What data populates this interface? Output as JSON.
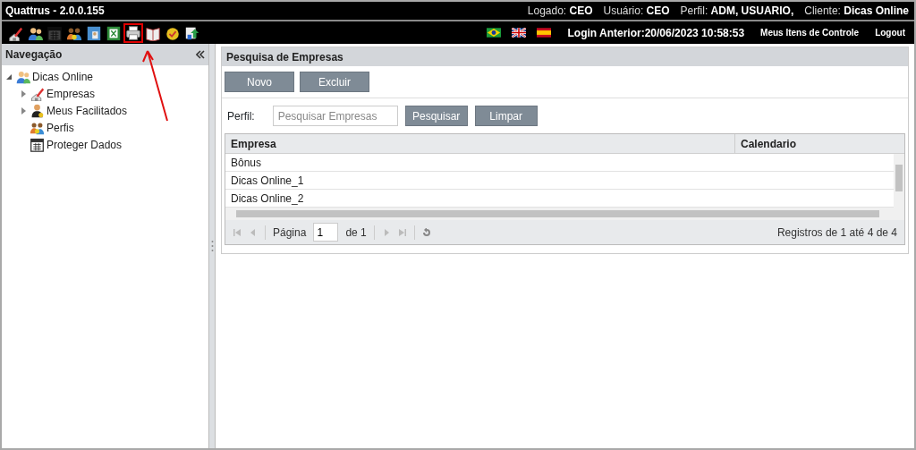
{
  "header": {
    "app_title": "Quattrus - 2.0.0.155",
    "session": [
      {
        "label": "Logado:",
        "value": "CEO"
      },
      {
        "label": "Usuário:",
        "value": "CEO"
      },
      {
        "label": "Perfil:",
        "value": "ADM, USUARIO,"
      },
      {
        "label": "Cliente:",
        "value": "Dicas Online"
      }
    ]
  },
  "toolbar": [
    {
      "kind": "house",
      "disabled": false,
      "highlighted": false
    },
    {
      "kind": "users",
      "disabled": false,
      "highlighted": false
    },
    {
      "kind": "calendar",
      "disabled": true,
      "highlighted": false
    },
    {
      "kind": "people",
      "disabled": false,
      "highlighted": false
    },
    {
      "kind": "image",
      "disabled": false,
      "highlighted": false
    },
    {
      "kind": "sheet",
      "disabled": false,
      "highlighted": false
    },
    {
      "kind": "printer",
      "disabled": false,
      "highlighted": true
    },
    {
      "kind": "book",
      "disabled": false,
      "highlighted": false
    },
    {
      "kind": "badge",
      "disabled": false,
      "highlighted": false
    },
    {
      "kind": "sync",
      "disabled": false,
      "highlighted": false
    }
  ],
  "languages": [
    {
      "kind": "brazil"
    },
    {
      "kind": "uk"
    },
    {
      "kind": "spain"
    }
  ],
  "last_login": "Login Anterior:20/06/2023 10:58:53",
  "links": [
    "Meus Itens de Controle",
    "Logout"
  ],
  "sidebar": {
    "title": "Navegação",
    "tree": [
      {
        "label": "Dicas Online",
        "kind": "users",
        "expanded": true,
        "children": [
          {
            "label": "Empresas",
            "kind": "house",
            "expanded": false
          },
          {
            "label": "Meus Facilitados",
            "kind": "person",
            "expanded": false
          },
          {
            "label": "Perfis",
            "kind": "people"
          },
          {
            "label": "Proteger Dados",
            "kind": "calendar"
          }
        ]
      }
    ]
  },
  "panel": {
    "title": "Pesquisa de Empresas",
    "actions": [
      "Novo",
      "Excluir"
    ],
    "search": {
      "label": "Perfil:",
      "placeholder": "Pesquisar Empresas",
      "buttons": [
        "Pesquisar",
        "Limpar"
      ]
    },
    "table": {
      "columns": [
        "Empresa",
        "Calendario"
      ],
      "rows": [
        {
          "empresa": "Bônus"
        },
        {
          "empresa": "Dicas Online_1"
        },
        {
          "empresa": "Dicas Online_2"
        }
      ]
    },
    "pager": {
      "page_label": "Página",
      "page": "1",
      "of": "de 1",
      "records": "Registros de 1 até 4 de 4"
    }
  }
}
